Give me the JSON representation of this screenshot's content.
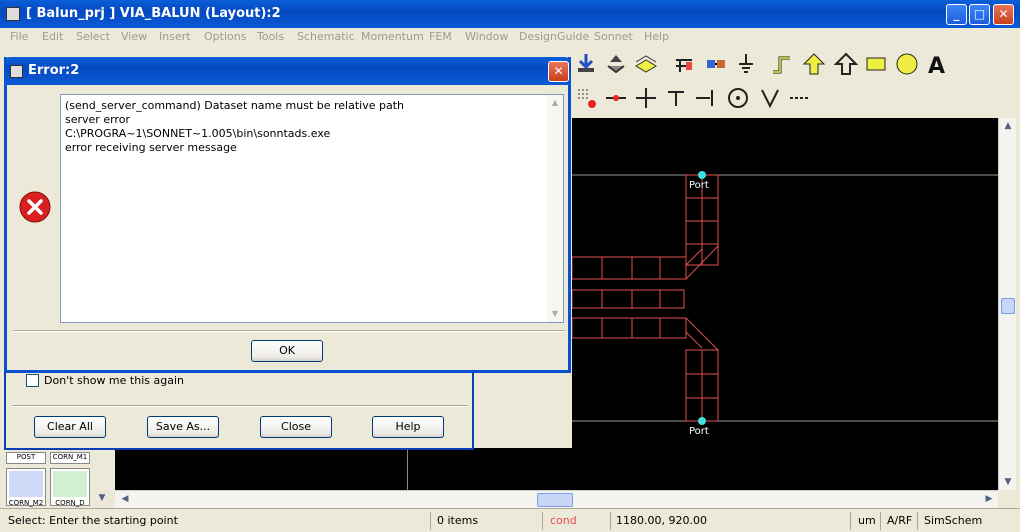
{
  "window": {
    "title": "[ Balun_prj ] VIA_BALUN (Layout):2",
    "minimize": "_",
    "maximize": "□",
    "close": "✕"
  },
  "menu": [
    "File",
    "Edit",
    "Select",
    "View",
    "Insert",
    "Options",
    "Tools",
    "Schematic",
    "Momentum",
    "FEM",
    "Window",
    "DesignGuide",
    "Sonnet",
    "Help"
  ],
  "palette": [
    {
      "label": "POST"
    },
    {
      "label": "CORN_M1"
    },
    {
      "label": "CORN_M2"
    },
    {
      "label": "CORN_D"
    }
  ],
  "canvas": {
    "port_top": "Port",
    "port_bottom": "Port"
  },
  "status": {
    "prompt": "Select: Enter the starting point",
    "items": "0 items",
    "layer": "cond",
    "coords": "1180.00, 920.00",
    "units": "um",
    "mode": "A/RF",
    "sim": "SimSchem"
  },
  "bg_dialog": {
    "dont_show": "Don't show me this again",
    "buttons": [
      "Clear All",
      "Save As...",
      "Close",
      "Help"
    ]
  },
  "error_dialog": {
    "title": "Error:2",
    "lines": [
      "(send_server_command) Dataset name must be relative path",
      "server error",
      "C:\\PROGRA~1\\SONNET~1.005\\bin\\sonntads.exe",
      "error receiving server message"
    ],
    "ok": "OK"
  },
  "colors": {
    "layout_line": "#e05050",
    "port_marker": "#40e0e0"
  }
}
